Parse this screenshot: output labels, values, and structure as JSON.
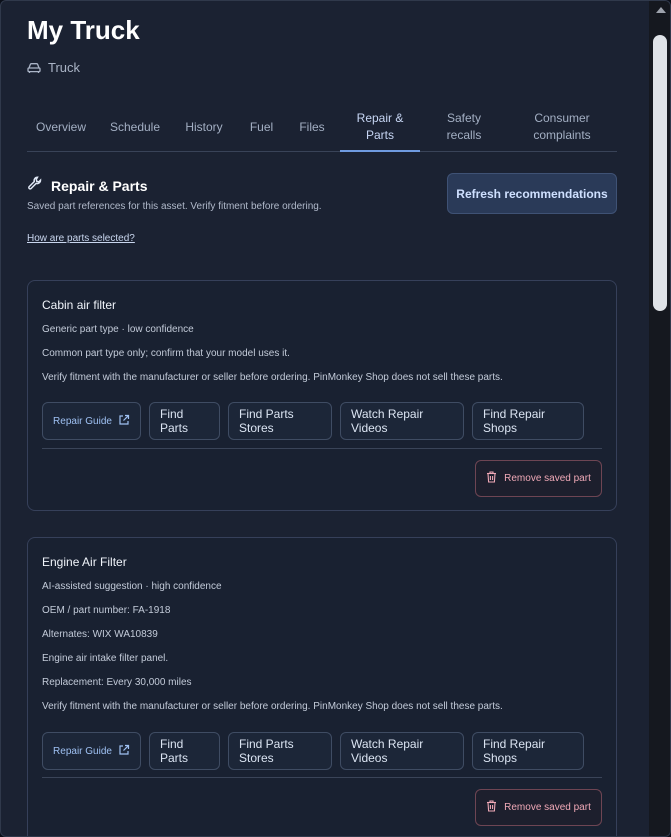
{
  "page": {
    "title": "My Truck",
    "asset_type": "Truck"
  },
  "tabs": [
    {
      "label": "Overview"
    },
    {
      "label": "Schedule"
    },
    {
      "label": "History"
    },
    {
      "label": "Fuel"
    },
    {
      "label": "Files"
    },
    {
      "label": "Repair &\nParts",
      "active": true
    },
    {
      "label": "Safety\nrecalls"
    },
    {
      "label": "Consumer\ncomplaints"
    }
  ],
  "section": {
    "title": "Repair & Parts",
    "description": "Saved part references for this asset. Verify fitment before ordering.",
    "help_link": "How are parts selected?",
    "refresh_label": "Refresh recommendations"
  },
  "actions": {
    "repair_guide": "Repair Guide",
    "find_parts": "Find Parts",
    "find_parts_stores": "Find Parts Stores",
    "watch_videos": "Watch Repair Videos",
    "find_shops": "Find Repair Shops",
    "remove": "Remove saved part"
  },
  "parts": [
    {
      "name": "Cabin air filter",
      "lines": [
        "Generic part type · low confidence",
        "Common part type only; confirm that your model uses it.",
        "Verify fitment with the manufacturer or seller before ordering. PinMonkey Shop does not sell these parts."
      ]
    },
    {
      "name": "Engine Air Filter",
      "lines": [
        "AI-assisted suggestion · high confidence",
        "OEM / part number: FA-1918",
        "Alternates: WIX WA10839",
        "Engine air intake filter panel.",
        "Replacement: Every 30,000 miles",
        "Verify fitment with the manufacturer or seller before ordering. PinMonkey Shop does not sell these parts."
      ]
    }
  ],
  "colors": {
    "background": "#1b2232",
    "card": "#192131",
    "accent": "#6f9be0",
    "danger": "#f0a9b7"
  },
  "icons": {
    "asset": "car-icon",
    "section": "wrench-icon",
    "external": "external-link-icon",
    "remove": "trash-icon"
  }
}
